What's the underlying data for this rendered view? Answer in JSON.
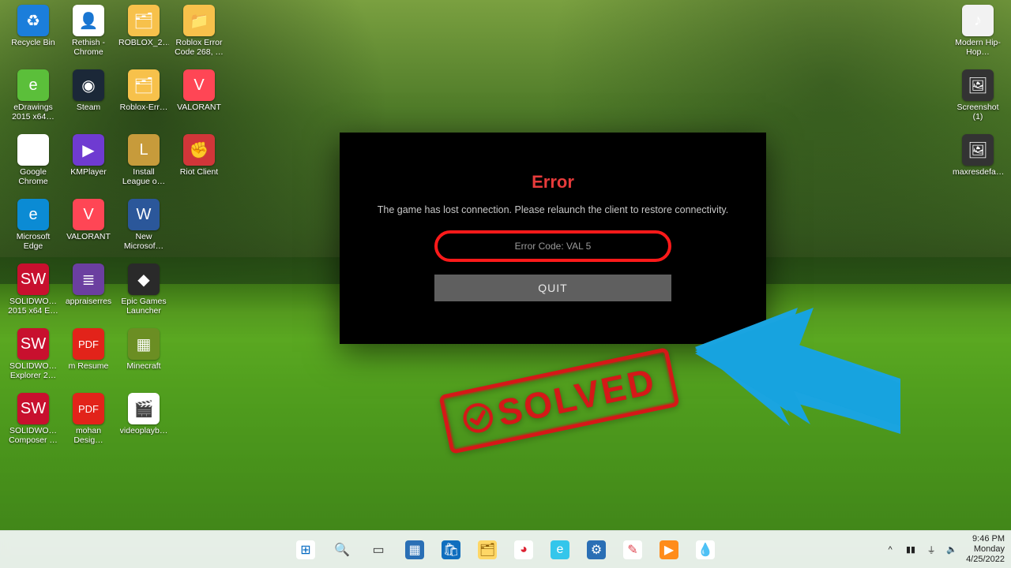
{
  "desktop_icons_left": [
    [
      {
        "label": "Recycle Bin",
        "glyph": "♻",
        "cls": "c-recycle"
      },
      {
        "label": "Rethish - Chrome",
        "glyph": "👤",
        "cls": "c-chrome"
      },
      {
        "label": "ROBLOX_2…",
        "glyph": "🗂",
        "cls": "c-folder"
      },
      {
        "label": "Roblox Error Code 268, …",
        "glyph": "📁",
        "cls": "c-folder"
      },
      {
        "label": "",
        "glyph": "",
        "cls": "",
        "empty": true
      }
    ],
    [
      {
        "label": "eDrawings 2015 x64…",
        "glyph": "e",
        "cls": "c-green"
      },
      {
        "label": "Steam",
        "glyph": "◉",
        "cls": "c-steam"
      },
      {
        "label": "Roblox-Err…",
        "glyph": "🗂",
        "cls": "c-folder"
      },
      {
        "label": "VALORANT",
        "glyph": "V",
        "cls": "c-val"
      },
      {
        "label": "",
        "glyph": "",
        "cls": "",
        "empty": true
      }
    ],
    [
      {
        "label": "Google Chrome",
        "glyph": "◯",
        "cls": "c-chrome"
      },
      {
        "label": "KMPlayer",
        "glyph": "▶",
        "cls": "c-km"
      },
      {
        "label": "Install League o…",
        "glyph": "L",
        "cls": "c-lol"
      },
      {
        "label": "Riot Client",
        "glyph": "✊",
        "cls": "c-riot"
      },
      {
        "label": "",
        "glyph": "",
        "cls": "",
        "empty": true
      }
    ],
    [
      {
        "label": "Microsoft Edge",
        "glyph": "e",
        "cls": "c-edge"
      },
      {
        "label": "VALORANT",
        "glyph": "V",
        "cls": "c-val"
      },
      {
        "label": "New Microsof…",
        "glyph": "W",
        "cls": "c-word"
      },
      {
        "label": "",
        "glyph": "",
        "cls": "",
        "empty": true
      },
      {
        "label": "",
        "glyph": "",
        "cls": "",
        "empty": true
      }
    ],
    [
      {
        "label": "SOLIDWO… 2015 x64 E…",
        "glyph": "SW",
        "cls": "c-sw"
      },
      {
        "label": "appraiserres",
        "glyph": "≣",
        "cls": "c-rar"
      },
      {
        "label": "Epic Games Launcher",
        "glyph": "◆",
        "cls": "c-epic"
      },
      {
        "label": "",
        "glyph": "",
        "cls": "",
        "empty": true
      },
      {
        "label": "",
        "glyph": "",
        "cls": "",
        "empty": true
      }
    ],
    [
      {
        "label": "SOLIDWO… Explorer 2…",
        "glyph": "SW",
        "cls": "c-sw"
      },
      {
        "label": "m Resume",
        "glyph": "PDF",
        "cls": "c-pdf"
      },
      {
        "label": "Minecraft",
        "glyph": "▦",
        "cls": "c-mc"
      },
      {
        "label": "",
        "glyph": "",
        "cls": "",
        "empty": true
      },
      {
        "label": "",
        "glyph": "",
        "cls": "",
        "empty": true
      }
    ],
    [
      {
        "label": "SOLIDWO… Composer …",
        "glyph": "SW",
        "cls": "c-sw"
      },
      {
        "label": "mohan Desig…",
        "glyph": "PDF",
        "cls": "c-pdf"
      },
      {
        "label": "videoplayb…",
        "glyph": "🎬",
        "cls": "c-chrome"
      },
      {
        "label": "",
        "glyph": "",
        "cls": "",
        "empty": true
      },
      {
        "label": "",
        "glyph": "",
        "cls": "",
        "empty": true
      }
    ]
  ],
  "desktop_icons_right": [
    {
      "label": "Modern Hip-Hop…",
      "glyph": "♪",
      "cls": "c-mp3"
    },
    {
      "label": "Screenshot (1)",
      "glyph": "🖼",
      "cls": "c-img"
    },
    {
      "label": "maxresdefa…",
      "glyph": "🖼",
      "cls": "c-img"
    }
  ],
  "dialog": {
    "title": "Error",
    "message": "The game has lost connection. Please relaunch the client to restore connectivity.",
    "code": "Error Code: VAL 5",
    "quit": "QUIT"
  },
  "stamp": {
    "text": "SOLVED"
  },
  "taskbar": {
    "items": [
      {
        "name": "start-button",
        "glyph": "⊞",
        "bg": "#fff",
        "fg": "#0067c0"
      },
      {
        "name": "search-button",
        "glyph": "🔍",
        "bg": "transparent",
        "fg": "#333"
      },
      {
        "name": "task-view-button",
        "glyph": "▭",
        "bg": "transparent",
        "fg": "#333"
      },
      {
        "name": "widgets-button",
        "glyph": "▦",
        "bg": "#2a6fb5",
        "fg": "#fff"
      },
      {
        "name": "microsoft-store-button",
        "glyph": "🛍",
        "bg": "#106ebe",
        "fg": "#fff"
      },
      {
        "name": "file-explorer-button",
        "glyph": "🗂",
        "bg": "#ffd766",
        "fg": "#8a5a00"
      },
      {
        "name": "photos-button",
        "glyph": "◕",
        "bg": "#fff",
        "fg": "#d23"
      },
      {
        "name": "edge-button",
        "glyph": "e",
        "bg": "#34c6eb",
        "fg": "#fff"
      },
      {
        "name": "settings-button",
        "glyph": "⚙",
        "bg": "#2a6fb5",
        "fg": "#fff"
      },
      {
        "name": "snipping-tool-button",
        "glyph": "✎",
        "bg": "#fff",
        "fg": "#e0434f"
      },
      {
        "name": "media-player-button",
        "glyph": "▶",
        "bg": "#ff8c1a",
        "fg": "#fff"
      },
      {
        "name": "paint-button",
        "glyph": "💧",
        "bg": "#fff",
        "fg": "#ff5ca0"
      }
    ],
    "tray": {
      "chevron": "^",
      "battery": "▮▮",
      "wifi": "⏚",
      "volume": "🔈",
      "time": "9:46 PM",
      "day": "Monday",
      "date": "4/25/2022"
    }
  }
}
